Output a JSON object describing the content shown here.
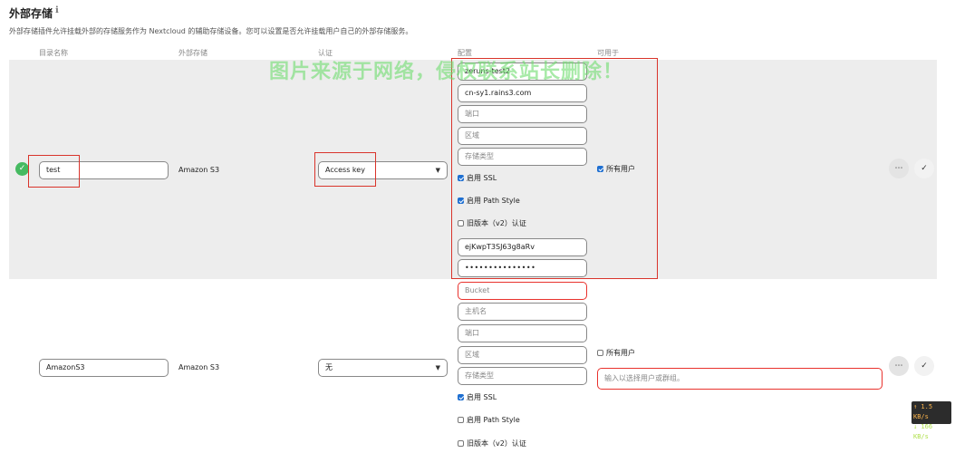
{
  "page": {
    "title": "外部存储",
    "info_icon": "ℹ",
    "description": "外部存储插件允许挂载外部的存储服务作为 Nextcloud 的辅助存储设备。您可以设置是否允许挂载用户自己的外部存储服务。"
  },
  "columns": {
    "folder_name": "目录名称",
    "external_storage": "外部存储",
    "authentication": "认证",
    "configuration": "配置",
    "available_for": "可用于"
  },
  "mounts": [
    {
      "status": "ok",
      "folder_name": "test",
      "backend": "Amazon S3",
      "auth": "Access key",
      "config": {
        "bucket": "zeruns-test2",
        "hostname": "cn-sy1.rains3.com",
        "port_placeholder": "端口",
        "region_placeholder": "区域",
        "storage_class_placeholder": "存储类型",
        "ssl_label": "启用 SSL",
        "ssl_checked": true,
        "path_style_label": "启用 Path Style",
        "path_style_checked": true,
        "legacy_label": "旧版本（v2）认证",
        "legacy_checked": false,
        "access_key": "ejKwpT3SJ63g8aRv",
        "secret_key": "•••••••••••••••"
      },
      "all_users_label": "所有用户",
      "all_users_checked": true
    },
    {
      "status": "none",
      "folder_name": "AmazonS3",
      "backend": "Amazon S3",
      "auth": "无",
      "config": {
        "bucket_placeholder": "Bucket",
        "hostname_placeholder": "主机名",
        "port_placeholder": "端口",
        "region_placeholder": "区域",
        "storage_class_placeholder": "存储类型",
        "ssl_label": "启用 SSL",
        "ssl_checked": true,
        "path_style_label": "启用 Path Style",
        "path_style_checked": false,
        "legacy_label": "旧版本（v2）认证",
        "legacy_checked": false
      },
      "all_users_label": "所有用户",
      "all_users_checked": false,
      "user_group_placeholder": "输入以选择用户或群组。"
    }
  ],
  "actions": {
    "more_icon": "⋯",
    "save_icon": "✓",
    "status_ok_icon": "✓"
  },
  "watermark": "图片来源于网络，侵权联系站长删除！",
  "speed_indicator": {
    "up": "↑ 1.5 KB/s",
    "down": "↓ 166 KB/s"
  },
  "colors": {
    "accent": "#1e6fd1",
    "success": "#46ba61",
    "error": "#e9322d",
    "highlight": "#d9342b"
  }
}
